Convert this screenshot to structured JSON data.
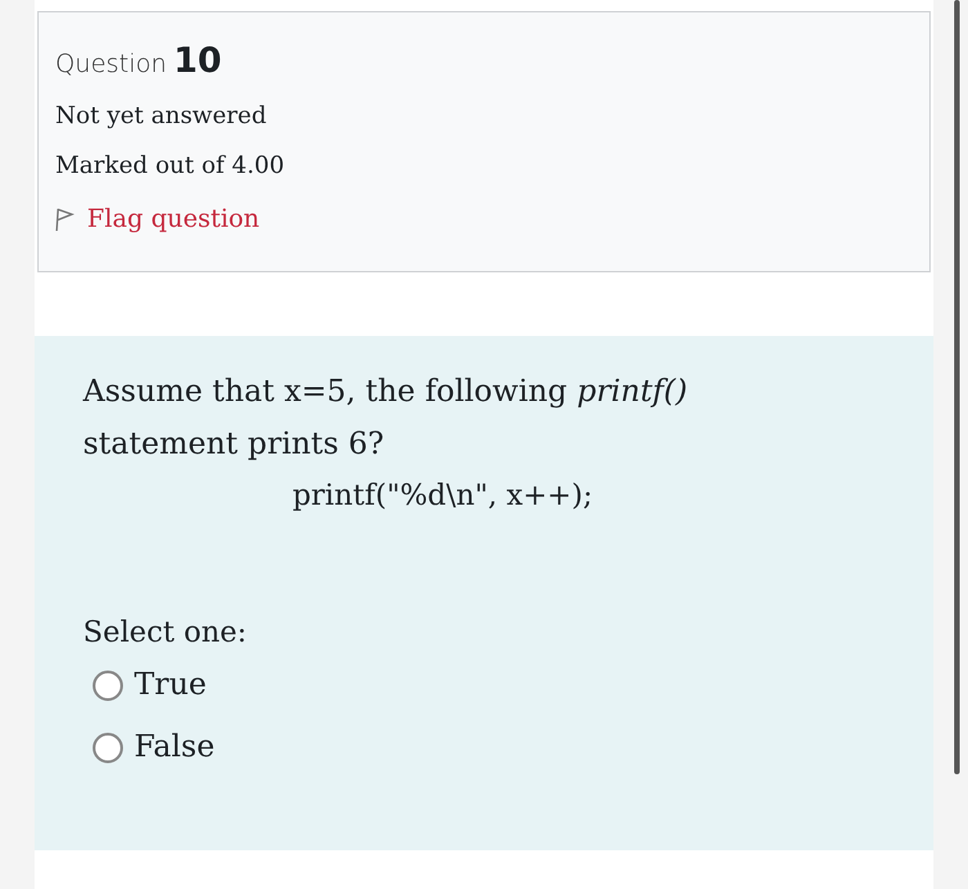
{
  "question": {
    "label": "Question",
    "number": "10",
    "status": "Not yet answered",
    "marks": "Marked out of 4.00",
    "flag": {
      "label": "Flag question",
      "flagged": false
    }
  },
  "formulation": {
    "text": "Assume that  x=5, the following *printf()*",
    "text_2": "statement prints 6?",
    "code": "printf(\"%d\\n\", x++);",
    "prompt": "Select one:",
    "options": [
      {
        "label": "True",
        "selected": false
      },
      {
        "label": "False",
        "selected": false
      }
    ]
  }
}
